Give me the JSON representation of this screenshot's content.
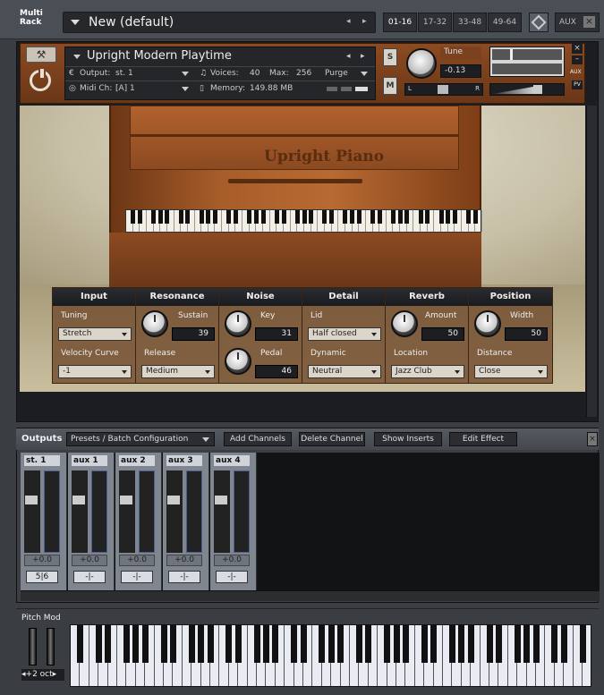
{
  "rack": {
    "title_line1": "Multi",
    "title_line2": "Rack",
    "preset_name": "New (default)",
    "prev_arrow": "◂",
    "next_arrow": "▸",
    "pages": [
      "01-16",
      "17-32",
      "33-48",
      "49-64"
    ],
    "active_page": "01-16",
    "aux_label": "AUX",
    "close_label": "×"
  },
  "instrument": {
    "name": "Upright Modern Playtime",
    "output_label": "Output:",
    "output_value": "st. 1",
    "voices_label": "Voices:",
    "voices_value": "40",
    "max_label": "Max:",
    "max_value": "256",
    "purge_label": "Purge",
    "midi_label": "Midi Ch:",
    "midi_value": "[A]  1",
    "memory_label": "Memory:",
    "memory_value": "149.88 MB",
    "solo_label": "S",
    "mute_label": "M",
    "tune_label": "Tune",
    "tune_value": "-0.13",
    "pan_left": "L",
    "pan_right": "R",
    "aux_small": "AUX",
    "pv_small": "PV"
  },
  "scene": {
    "logo": "Upright Piano"
  },
  "controls": {
    "input": {
      "header": "Input",
      "tuning_label": "Tuning",
      "tuning_value": "Stretch",
      "velocity_label": "Velocity Curve",
      "velocity_value": "-1"
    },
    "resonance": {
      "header": "Resonance",
      "sustain_label": "Sustain",
      "sustain_value": "39",
      "release_label": "Release",
      "release_value": "Medium"
    },
    "noise": {
      "header": "Noise",
      "key_label": "Key",
      "key_value": "31",
      "pedal_label": "Pedal",
      "pedal_value": "46"
    },
    "detail": {
      "header": "Detail",
      "lid_label": "Lid",
      "lid_value": "Half closed",
      "dynamic_label": "Dynamic",
      "dynamic_value": "Neutral"
    },
    "reverb": {
      "header": "Reverb",
      "amount_label": "Amount",
      "amount_value": "50",
      "location_label": "Location",
      "location_value": "Jazz Club"
    },
    "position": {
      "header": "Position",
      "width_label": "Width",
      "width_value": "50",
      "distance_label": "Distance",
      "distance_value": "Close"
    }
  },
  "outputs": {
    "title": "Outputs",
    "presets_label": "Presets / Batch Configuration",
    "add_channels": "Add Channels",
    "delete_channel": "Delete Channel",
    "show_inserts": "Show Inserts",
    "edit_effect": "Edit Effect",
    "close": "×",
    "channels": [
      {
        "name": "st. 1",
        "db": "+0.0",
        "io": "5|6"
      },
      {
        "name": "aux 1",
        "db": "+0.0",
        "io": "-|-"
      },
      {
        "name": "aux 2",
        "db": "+0.0",
        "io": "-|-"
      },
      {
        "name": "aux 3",
        "db": "+0.0",
        "io": "-|-"
      },
      {
        "name": "aux 4",
        "db": "+0.0",
        "io": "-|-"
      }
    ]
  },
  "keyboard": {
    "pitch_mod": "Pitch Mod",
    "octave": "+2 oct",
    "oct_left": "◂",
    "oct_right": "▸"
  }
}
